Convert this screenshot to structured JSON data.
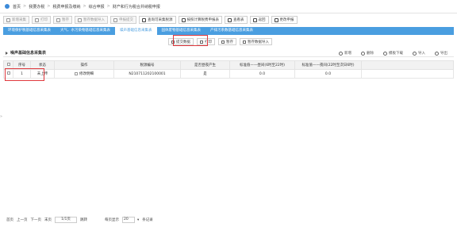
{
  "breadcrumb": [
    "首页",
    "我要办税",
    "税费申报及缴纳",
    "综合申报",
    "财产和行为税合并纳税申报"
  ],
  "toolbar": [
    {
      "label": "新增采集",
      "enabled": false
    },
    {
      "label": "打印",
      "enabled": false
    },
    {
      "label": "暂存",
      "enabled": false
    },
    {
      "label": "暂存数据导入",
      "enabled": false
    },
    {
      "label": "申报提交",
      "enabled": false
    },
    {
      "label": "查询可采集税源",
      "enabled": true
    },
    {
      "label": "按照计算税费申报表",
      "enabled": true
    },
    {
      "label": "查看表",
      "enabled": true
    },
    {
      "label": "返回",
      "enabled": true
    },
    {
      "label": "更改申报",
      "enabled": true
    }
  ],
  "tabs": [
    "环境保护税基础信息采集表",
    "大气、水污染物基础信息采集表",
    "噪声基础信息采集表",
    "固体废物基础信息采集表",
    "产排污系数基础信息采集表"
  ],
  "active_tab": 2,
  "subbar": {
    "submit": "提交数据",
    "print": "打印",
    "save": "暂存",
    "import": "暂存数据导入"
  },
  "panel": {
    "title": "噪声基础信息采集表",
    "actions": [
      "新增",
      "删除",
      "模板下载",
      "导入",
      "导出"
    ]
  },
  "table": {
    "headers": [
      "",
      "序号",
      "状态",
      "操作",
      "税源编号",
      "是否昼夜产生",
      "标准值——昼间(6时至22时)",
      "标准值——夜间(22时至次日6时)",
      ""
    ],
    "rows": [
      {
        "no": "1",
        "status": "未上传",
        "op": "修改明细",
        "id": "N210711202100001",
        "daynight": "是",
        "day": "0.0",
        "night": "0.0"
      }
    ]
  },
  "pager": {
    "first": "首页",
    "prev": "上一页",
    "next": "下一页",
    "last": "末页",
    "page": "1/1页",
    "goto": "跳转",
    "per_page_label": "每页显示",
    "per_page": "20",
    "count_suffix": "条记录"
  }
}
